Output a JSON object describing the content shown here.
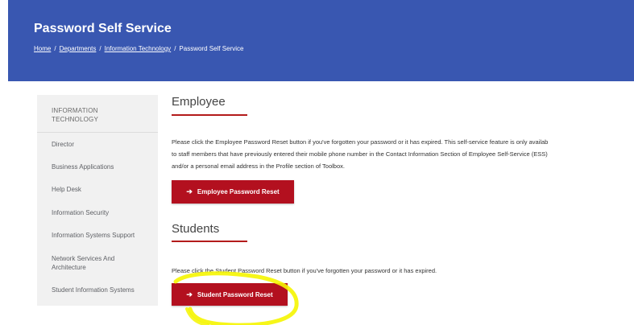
{
  "header": {
    "title": "Password Self Service",
    "breadcrumb": {
      "home": "Home",
      "departments": "Departments",
      "it": "Information Technology",
      "current": "Password Self Service",
      "separator": "/"
    }
  },
  "sidebar": {
    "heading_line1": "INFORMATION",
    "heading_line2": "TECHNOLOGY",
    "items": [
      {
        "label": "Director"
      },
      {
        "label": "Business Applications"
      },
      {
        "label": "Help Desk"
      },
      {
        "label": "Information Security"
      },
      {
        "label": "Information Systems Support"
      },
      {
        "label": "Network Services And Architecture"
      },
      {
        "label": "Student Information Systems"
      }
    ]
  },
  "employee": {
    "title": "Employee",
    "line1": "Please click the Employee Password Reset button if you've forgotten your password or it has expired. This self-service feature is only availab",
    "line2": "to staff members that have previously entered their mobile phone number in the Contact Information Section of Employee Self-Service (ESS)",
    "line3": "and/or a personal email address in the Profile section of Toolbox.",
    "button_label": "Employee Password Reset",
    "button_icon": "arrow-right-icon"
  },
  "students": {
    "title": "Students",
    "text": "Please click the Student Password Reset button if you've forgotten your password or it has expired.",
    "button_label": "Student Password Reset",
    "button_icon": "arrow-right-icon"
  },
  "colors": {
    "banner": "#3957b1",
    "accent_red": "#b3101f",
    "highlighter": "#f5f500"
  }
}
